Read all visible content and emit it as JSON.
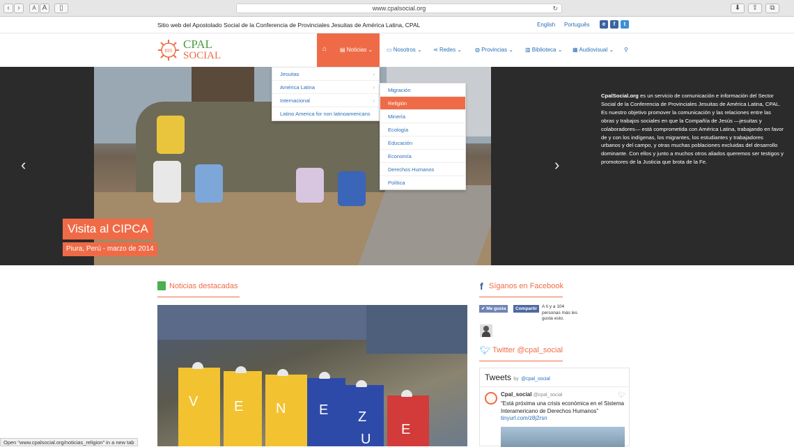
{
  "browser": {
    "url": "www.cpalsocial.org",
    "status_text": "Open “www.cpalsocial.org/noticias_religion” in a new tab"
  },
  "topbar": {
    "tagline": "Sitio web del Apostolado Social de la Conferencia de Provinciales Jesuitas de América Latina, CPAL",
    "lang_en": "English",
    "lang_pt": "Português",
    "social": [
      "e",
      "f",
      "t"
    ]
  },
  "logo": {
    "line1": "CPAL",
    "line2": "SOCIAL",
    "seal": "IHS"
  },
  "nav": {
    "items": [
      "Noticias",
      "Nosotros",
      "Redes",
      "Provincias",
      "Biblioteca",
      "Audiovisual"
    ],
    "active_color": "#ef6b47"
  },
  "dropdown": {
    "level1": [
      "Jesuitas",
      "América Latina",
      "Internacional",
      "Latino America for non latinoamericans"
    ],
    "level2": [
      "Migración",
      "Religión",
      "Minería",
      "Ecología",
      "Educación",
      "Economía",
      "Derechos Humanos",
      "Política"
    ],
    "selected": "Religión"
  },
  "hero": {
    "caption_title": "Visita al CIPCA",
    "caption_sub": "Piura, Perú - marzo de 2014",
    "text_bold": "CpalSocial.org",
    "text": " es un servicio de comunicación e información del Sector Social de la Conferencia de Provinciales Jesuitas de América Latina, CPAL. Es nuestro objetivo promover la comunicación y las relaciones entre las obras y trabajos sociales en que la Compañía de Jesús —jesuitas y colaboradores— está comprometida con América Latina, trabajando en favor de y con los indígenas, los migrantes, los estudiantes y trabajadores urbanos y del campo, y otras muchas poblaciones excluidas del desarrollo dominante. Con ellos y junto a muchos otros aliados queremos ser testigos y promotores de la Justicia que brota de la Fe."
  },
  "sections": {
    "noticias": "Noticias destacadas",
    "facebook": "Síganos en Facebook",
    "twitter": "Twitter @cpal_social"
  },
  "facebook": {
    "like": "Me gusta",
    "share": "Compartir",
    "count_text": "A ti y a 104 personas más les gusta esto."
  },
  "tweets": {
    "header": "Tweets",
    "by": "by",
    "handle": "@cpal_social",
    "author": "Cpal_social",
    "author_handle": "@cpal_social",
    "text": "“Está próxima una crisis económica en el Sistema Interamericano de Derechos Humanos”",
    "link": "tinyurl.com/z8j2rsn"
  },
  "feature_letters": [
    "V",
    "E",
    "N",
    "E",
    "Z",
    "U",
    "E"
  ]
}
